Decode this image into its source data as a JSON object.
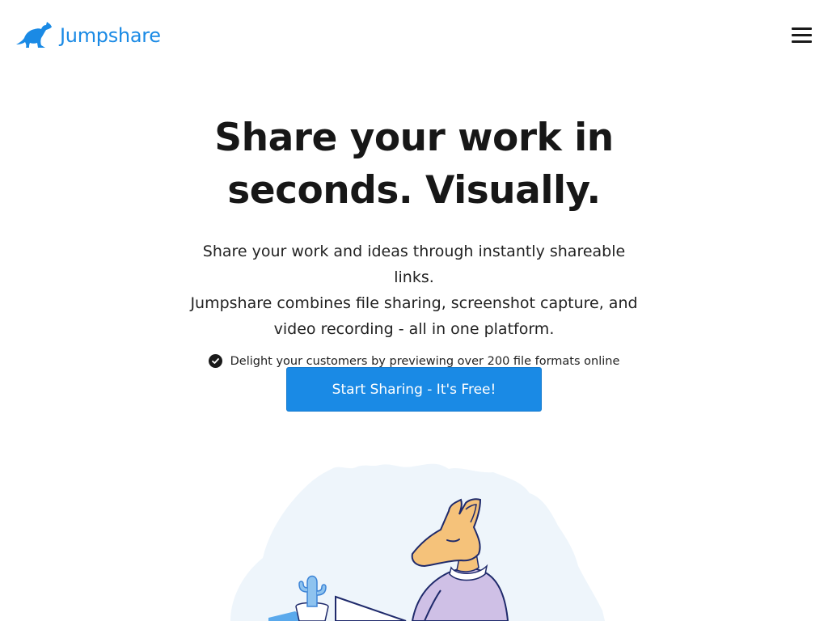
{
  "header": {
    "brand_name": "Jumpshare",
    "logo_icon": "kangaroo-icon",
    "menu_icon": "hamburger-menu-icon"
  },
  "hero": {
    "title_line1": "Share your work in",
    "title_line2": "seconds. Visually.",
    "subtitle_line1": "Share your work and ideas through instantly shareable links.",
    "subtitle_line2": "Jumpshare combines file sharing, screenshot capture, and",
    "subtitle_line3": "video recording - all in one platform.",
    "feature_text": "Delight your customers by previewing over 200 file formats online",
    "feature_icon": "check-circle-icon",
    "cta_label": "Start Sharing - It's Free!"
  },
  "colors": {
    "brand_blue": "#1a8ae5",
    "text_dark": "#171717",
    "illustration_bg": "#eef5fb",
    "kangaroo_skin": "#f5c27a",
    "sweater": "#cfc0e6"
  }
}
